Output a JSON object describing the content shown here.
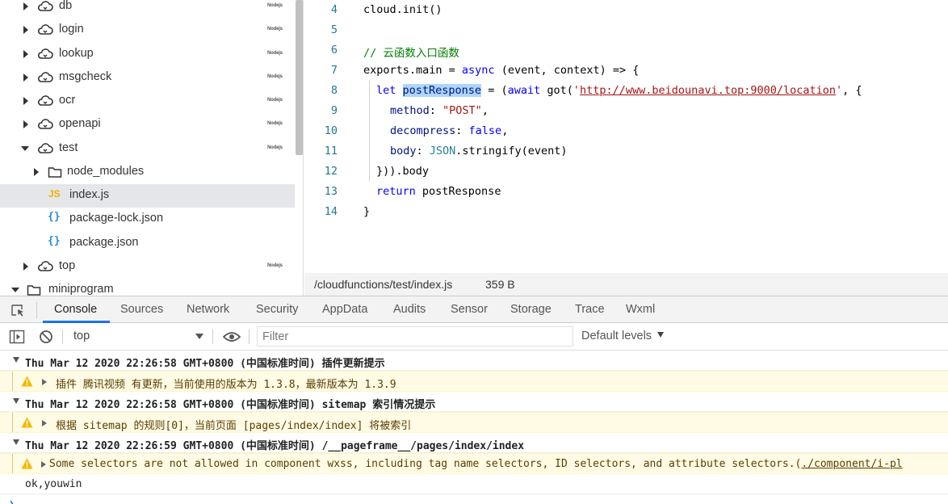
{
  "file_tree": {
    "items": [
      {
        "label": "db",
        "node_badge": "Nodejs"
      },
      {
        "label": "login",
        "node_badge": "Nodejs"
      },
      {
        "label": "lookup",
        "node_badge": "Nodejs"
      },
      {
        "label": "msgcheck",
        "node_badge": "Nodejs"
      },
      {
        "label": "ocr",
        "node_badge": "Nodejs"
      },
      {
        "label": "openapi",
        "node_badge": "Nodejs"
      },
      {
        "label": "test",
        "node_badge": "Nodejs"
      },
      {
        "label": "node_modules"
      },
      {
        "label": "index.js",
        "icon_text": "JS"
      },
      {
        "label": "package-lock.json",
        "icon_text": "{}"
      },
      {
        "label": "package.json",
        "icon_text": "{}"
      },
      {
        "label": "top",
        "node_badge": "Nodejs"
      },
      {
        "label": "miniprogram"
      }
    ]
  },
  "editor": {
    "line_numbers": [
      "4",
      "5",
      "6",
      "7",
      "8",
      "9",
      "10",
      "11",
      "12",
      "13",
      "14"
    ],
    "tokens": {
      "l4": "cloud.init()",
      "l6": "// 云函数入口函数",
      "l7_a": "exports.main = ",
      "l7_async": "async",
      "l7_b": " (event, context) => {",
      "l8_let": "let",
      "l8_sp": " ",
      "l8_var": "postResponse",
      "l8_b": " = (",
      "l8_await": "await",
      "l8_c": " got(",
      "l8_q1": "'",
      "l8_url": "http://www.beidounavi.top:9000/location",
      "l8_q2": "'",
      "l8_d": ", {",
      "l9_key": "method",
      "l9_b": ": ",
      "l9_str": "\"POST\"",
      "l9_c": ",",
      "l10_key": "decompress",
      "l10_b": ": ",
      "l10_false": "false",
      "l10_c": ",",
      "l11_key": "body",
      "l11_b": ": ",
      "l11_json": "JSON",
      "l11_c": ".stringify(event)",
      "l12": "})).body",
      "l13_return": "return",
      "l13_b": " postResponse",
      "l14": "}"
    }
  },
  "status_bar": {
    "path": "/cloudfunctions/test/index.js",
    "size": "359 B"
  },
  "devtools": {
    "tabs": [
      "Console",
      "Sources",
      "Network",
      "Security",
      "AppData",
      "Audits",
      "Sensor",
      "Storage",
      "Trace",
      "Wxml"
    ],
    "active_tab": "Console",
    "accent_color": "#1a73e8"
  },
  "console_toolbar": {
    "context": "top",
    "filter_placeholder": "Filter",
    "levels": "Default levels"
  },
  "console": {
    "group1": "Thu Mar 12 2020 22:26:58 GMT+0800 (中国标准时间) 插件更新提示",
    "warn1": "插件 腾讯视频 有更新，当前使用的版本为 1.3.8，最新版本为 1.3.9",
    "group2": "Thu Mar 12 2020 22:26:58 GMT+0800 (中国标准时间) sitemap 索引情况提示",
    "warn2": "根据 sitemap 的规则[0]，当前页面 [pages/index/index] 将被索引",
    "group3": "Thu Mar 12 2020 22:26:59 GMT+0800 (中国标准时间) /__pageframe__/pages/index/index",
    "warn3": "Some selectors are not allowed in component wxss, including tag name selectors, ID selectors, and attribute selectors.(",
    "warn3_link": "./component/i-pl",
    "log1": "ok,youwin",
    "warning_color": "#fffbe5"
  }
}
